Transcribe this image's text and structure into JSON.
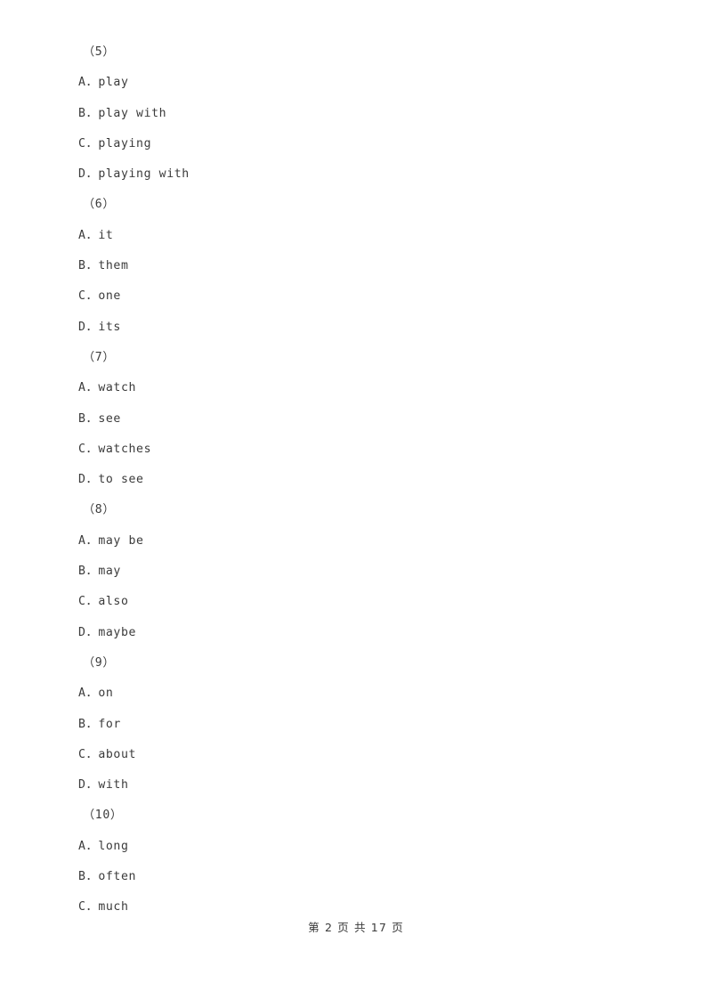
{
  "document": {
    "page_background": "#ffffff",
    "text_color": "#3b3b3b"
  },
  "questions": [
    {
      "number": "（5）",
      "options": [
        {
          "letter": "A",
          "sep": "．",
          "text": "play"
        },
        {
          "letter": "B",
          "sep": "．",
          "text": "play with"
        },
        {
          "letter": "C",
          "sep": "．",
          "text": "playing"
        },
        {
          "letter": "D",
          "sep": "．",
          "text": "playing with"
        }
      ]
    },
    {
      "number": "（6）",
      "options": [
        {
          "letter": "A",
          "sep": "．",
          "text": "it"
        },
        {
          "letter": "B",
          "sep": "．",
          "text": "them"
        },
        {
          "letter": "C",
          "sep": "．",
          "text": "one"
        },
        {
          "letter": "D",
          "sep": "．",
          "text": "its"
        }
      ]
    },
    {
      "number": "（7）",
      "options": [
        {
          "letter": "A",
          "sep": "．",
          "text": "watch"
        },
        {
          "letter": "B",
          "sep": "．",
          "text": "see"
        },
        {
          "letter": "C",
          "sep": "．",
          "text": "watches"
        },
        {
          "letter": "D",
          "sep": "．",
          "text": "to see"
        }
      ]
    },
    {
      "number": "（8）",
      "options": [
        {
          "letter": "A",
          "sep": "．",
          "text": "may be"
        },
        {
          "letter": "B",
          "sep": "．",
          "text": "may"
        },
        {
          "letter": "C",
          "sep": "．",
          "text": "also"
        },
        {
          "letter": "D",
          "sep": "．",
          "text": "maybe"
        }
      ]
    },
    {
      "number": "（9）",
      "options": [
        {
          "letter": "A",
          "sep": "．",
          "text": "on"
        },
        {
          "letter": "B",
          "sep": "．",
          "text": "for"
        },
        {
          "letter": "C",
          "sep": "．",
          "text": "about"
        },
        {
          "letter": "D",
          "sep": "．",
          "text": "with"
        }
      ]
    },
    {
      "number": "（10）",
      "options": [
        {
          "letter": "A",
          "sep": "．",
          "text": "long"
        },
        {
          "letter": "B",
          "sep": "．",
          "text": "often"
        },
        {
          "letter": "C",
          "sep": "．",
          "text": "much"
        }
      ]
    }
  ],
  "footer": {
    "text": "第 2 页 共 17 页",
    "current_page": "2",
    "total_pages": "17"
  }
}
